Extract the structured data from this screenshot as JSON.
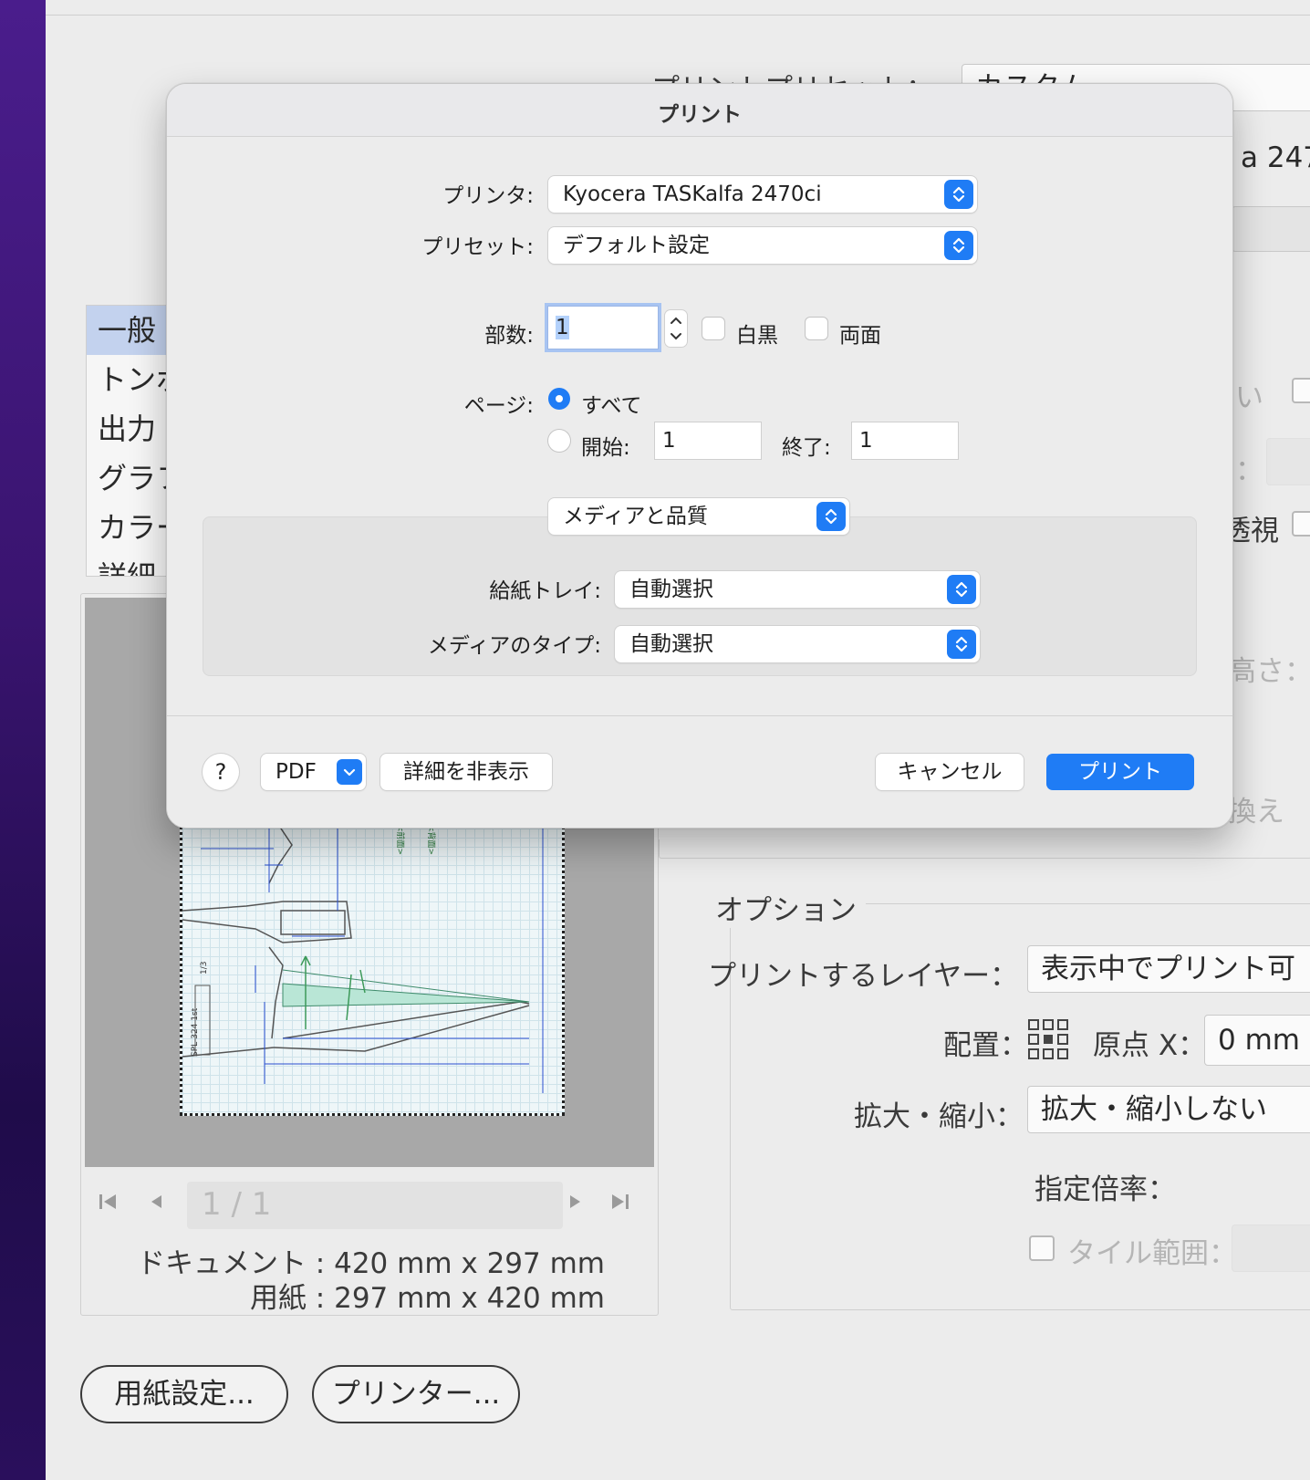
{
  "background": {
    "preset_label": "プリントプリセット：",
    "preset_value": "カスタム",
    "printer_partial": "a 247(",
    "list_items": [
      "一般",
      "トンボ",
      "出力",
      "グラフ",
      "カラー",
      "詳細"
    ],
    "right_partials": {
      "r1": "い",
      "r2": "：",
      "r3": "透視",
      "r4": "高さ：",
      "r5": "換え"
    },
    "page_nav": "1 / 1",
    "document_size": "ドキュメント : 420 mm x 297 mm",
    "paper_size": "用紙 : 297 mm x 420 mm",
    "options_title": "オプション",
    "layer_label": "プリントするレイヤー：",
    "layer_value": "表示中でプリント可",
    "placement_label": "配置：",
    "origin_x_label": "原点 X：",
    "origin_x_value": "0 mm",
    "scale_label": "拡大・縮小：",
    "scale_value": "拡大・縮小しない",
    "ratio_label": "指定倍率：",
    "tile_label": "タイル範囲：",
    "page_setup_button": "用紙設定...",
    "printer_button": "プリンター..."
  },
  "dialog": {
    "title": "プリント",
    "printer_label": "プリンタ:",
    "printer_value": "Kyocera TASKalfa 2470ci",
    "preset_label": "プリセット:",
    "preset_value": "デフォルト設定",
    "copies_label": "部数:",
    "copies_value": "1",
    "bw_label": "白黒",
    "duplex_label": "両面",
    "pages_label": "ページ:",
    "all_label": "すべて",
    "from_label": "開始:",
    "from_value": "1",
    "to_label": "終了:",
    "to_value": "1",
    "section_value": "メディアと品質",
    "tray_label": "給紙トレイ:",
    "tray_value": "自動選択",
    "media_type_label": "メディアのタイプ:",
    "media_type_value": "自動選択",
    "help_label": "?",
    "pdf_label": "PDF",
    "hide_details_label": "詳細を非表示",
    "cancel_label": "キャンセル",
    "print_label": "プリント"
  },
  "colors": {
    "accent": "#1f7cf5"
  }
}
